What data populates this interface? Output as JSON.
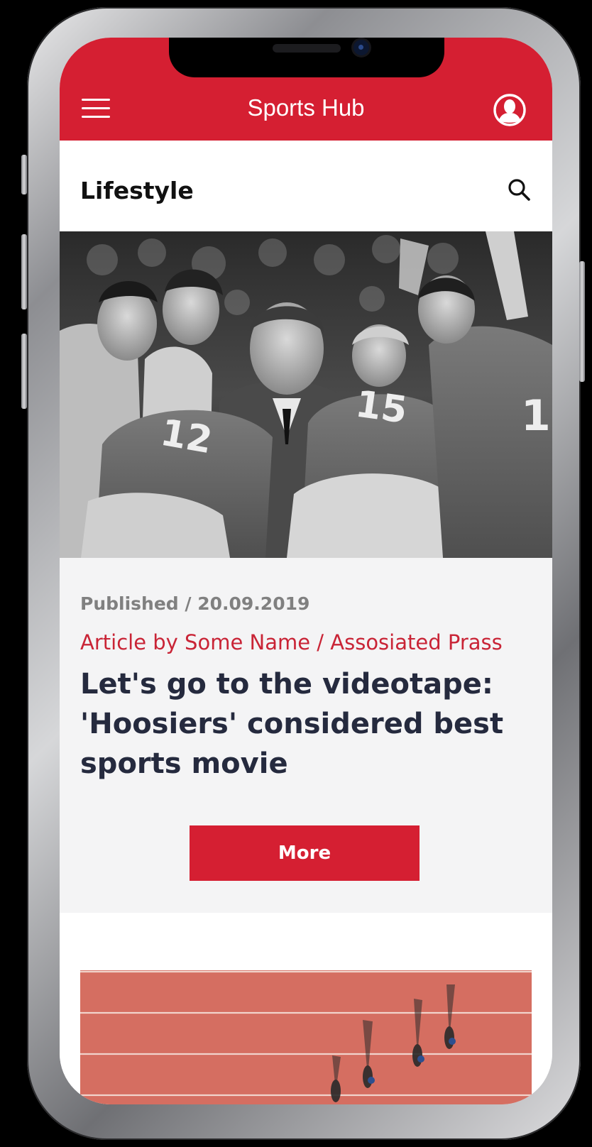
{
  "app": {
    "title": "Sports Hub",
    "accent_color": "#d51f32"
  },
  "header": {
    "menu_icon": "hamburger-menu-icon",
    "profile_icon": "user-profile-icon"
  },
  "section": {
    "title": "Lifestyle",
    "search_icon": "search-icon"
  },
  "article": {
    "image": "basketball-team-huddle-photo",
    "published": "Published / 20.09.2019",
    "byline": "Article by Some Name / Assosiated Prass",
    "headline": "Let's go to the videotape: 'Hoosiers' considered best sports movie",
    "more_label": "More"
  },
  "next_article": {
    "image": "running-track-aerial-photo"
  }
}
